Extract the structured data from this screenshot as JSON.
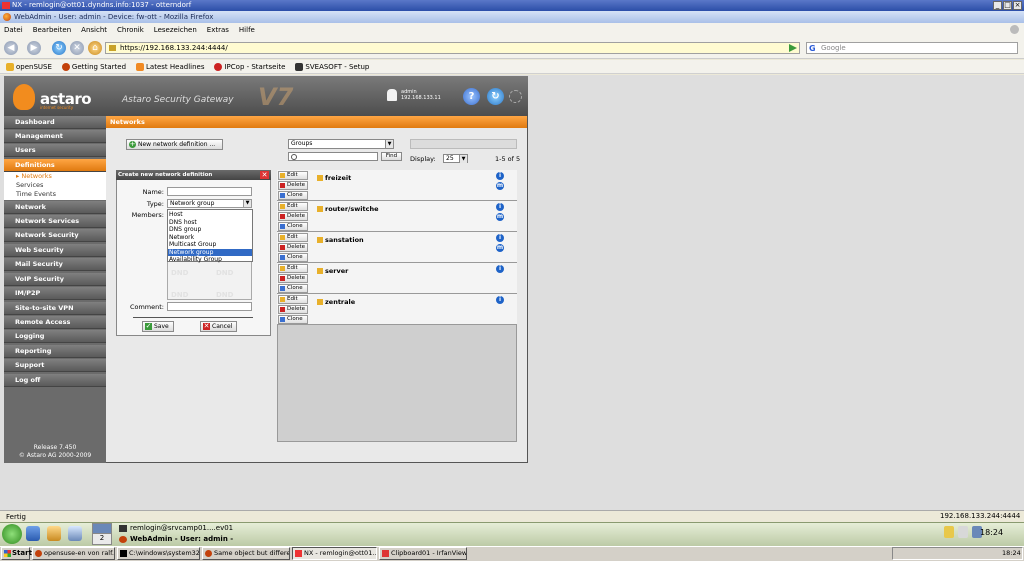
{
  "nx_window": {
    "title": "NX - remlogin@ott01.dyndns.info:1037 - otterndorf",
    "buttons": [
      "_",
      "□",
      "×"
    ]
  },
  "browser": {
    "title": "WebAdmin - User: admin - Device: fw-ott - Mozilla Firefox",
    "menu": [
      "Datei",
      "Bearbeiten",
      "Ansicht",
      "Chronik",
      "Lesezeichen",
      "Extras",
      "Hilfe"
    ],
    "url": "https://192.168.133.244:4444/",
    "search_placeholder": "Google",
    "bookmarks": [
      {
        "label": "openSUSE",
        "color": "#e8b02a"
      },
      {
        "label": "Getting Started",
        "color": "#c3410b"
      },
      {
        "label": "Latest Headlines",
        "color": "#f08a24"
      },
      {
        "label": "IPCop - Startseite",
        "color": "#cc2222"
      },
      {
        "label": "SVEASOFT - Setup",
        "color": "#333333"
      }
    ],
    "status_text": "Fertig",
    "status_ip": "192.168.133.244:4444"
  },
  "app": {
    "logo": "astaro",
    "logo_sub": "internet security",
    "product": "Astaro Security Gateway",
    "version_mark": "V7",
    "user": {
      "name": "admin",
      "ip": "192.168.133.11"
    },
    "sidebar": [
      {
        "label": "Dashboard"
      },
      {
        "label": "Management"
      },
      {
        "label": "Users"
      },
      {
        "label": "Definitions",
        "active": true
      },
      {
        "label": "Network"
      },
      {
        "label": "Network Services"
      },
      {
        "label": "Network Security"
      },
      {
        "label": "Web Security"
      },
      {
        "label": "Mail Security"
      },
      {
        "label": "VoIP Security"
      },
      {
        "label": "IM/P2P"
      },
      {
        "label": "Site-to-site VPN"
      },
      {
        "label": "Remote Access"
      },
      {
        "label": "Logging"
      },
      {
        "label": "Reporting"
      },
      {
        "label": "Support"
      },
      {
        "label": "Log off"
      }
    ],
    "sidebar_sub": [
      {
        "label": "Networks",
        "active": true
      },
      {
        "label": "Services"
      },
      {
        "label": "Time Events"
      }
    ],
    "release": "Release 7.450",
    "copyright": "© Astaro AG 2000-2009",
    "page_title": "Networks",
    "new_button": "New network definition ...",
    "filter": {
      "groups_value": "Groups",
      "find_label": "Find",
      "display_label": "Display:",
      "display_value": "25",
      "count": "1-5 of 5"
    },
    "create_panel": {
      "title": "Create new network definition",
      "name_label": "Name:",
      "type_label": "Type:",
      "type_value": "Network group",
      "members_label": "Members:",
      "comment_label": "Comment:",
      "save_label": "Save",
      "cancel_label": "Cancel",
      "dnd": "DND",
      "type_options": [
        "Host",
        "DNS host",
        "DNS group",
        "Network",
        "Multicast Group",
        "Network group",
        "Availability Group"
      ],
      "selected_option": "Network group"
    },
    "row_buttons": {
      "edit": "Edit",
      "delete": "Delete",
      "clone": "Clone"
    },
    "groups": [
      {
        "name": "freizeit",
        "info_count": 2
      },
      {
        "name": "router/switche",
        "info_count": 2
      },
      {
        "name": "sanstation",
        "info_count": 2
      },
      {
        "name": "server",
        "info_count": 1
      },
      {
        "name": "zentrale",
        "info_count": 1
      }
    ]
  },
  "kde_panel": {
    "pager_number": "2",
    "tasks": [
      "remlogin@srvcamp01....ev01",
      "WebAdmin - User: admin -"
    ],
    "clock": "18:24"
  },
  "windows_taskbar": {
    "start": "Start",
    "tasks": [
      "opensuse-en von ralf.pr...",
      "C:\\windows\\system32\\c...",
      "Same object but differen...",
      "NX - remlogin@ott01...",
      "Clipboard01 - IrfanView (..."
    ],
    "active_task": 3,
    "clock": "18:24"
  }
}
